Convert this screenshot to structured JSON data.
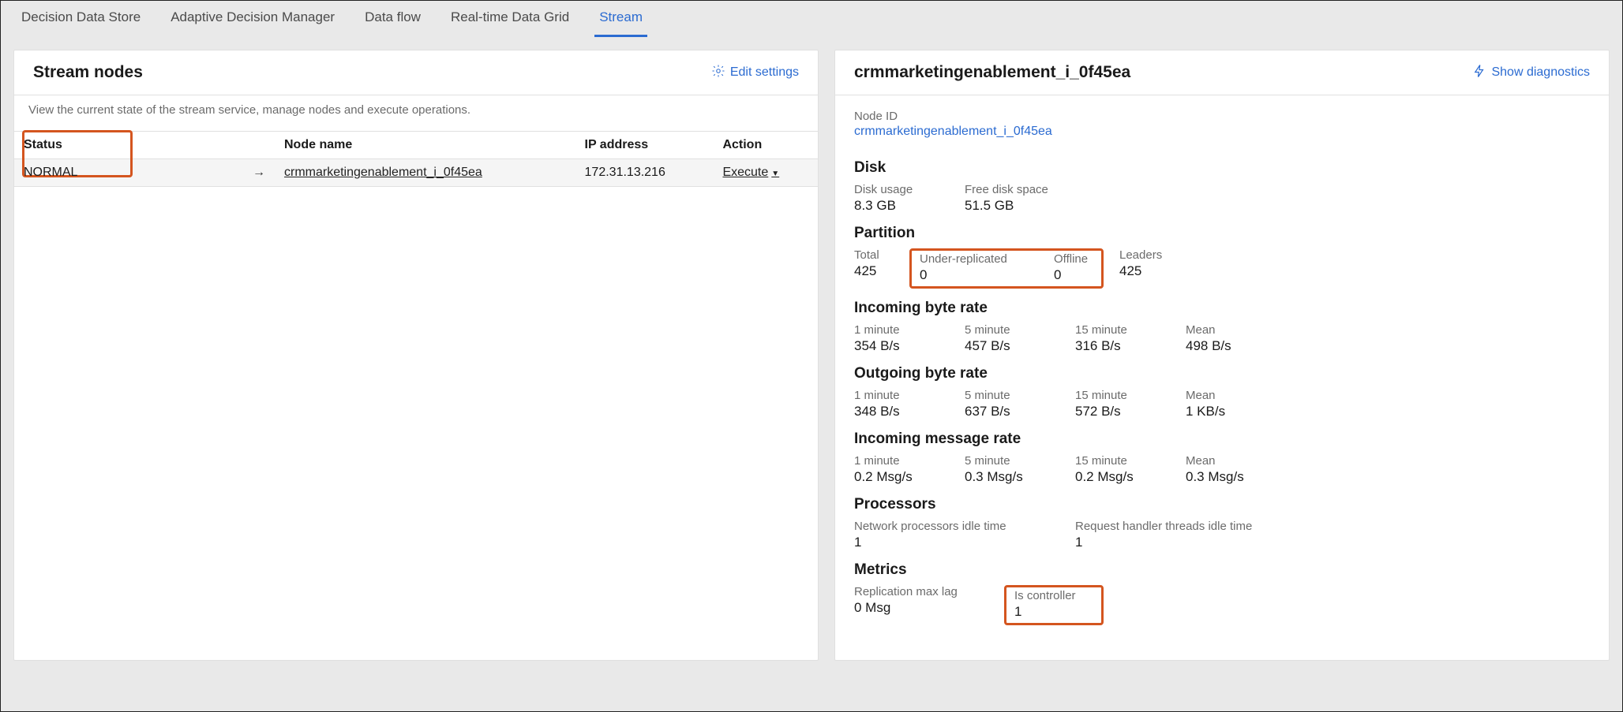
{
  "tabs": {
    "items": [
      {
        "label": "Decision Data Store",
        "active": false
      },
      {
        "label": "Adaptive Decision Manager",
        "active": false
      },
      {
        "label": "Data flow",
        "active": false
      },
      {
        "label": "Real-time Data Grid",
        "active": false
      },
      {
        "label": "Stream",
        "active": true
      }
    ]
  },
  "left": {
    "title": "Stream nodes",
    "edit_label": "Edit settings",
    "description": "View the current state of the stream service, manage nodes and execute operations.",
    "columns": {
      "status": "Status",
      "node_name": "Node name",
      "ip": "IP address",
      "action": "Action"
    },
    "rows": [
      {
        "status": "NORMAL",
        "node_name": "crmmarketingenablement_i_0f45ea",
        "ip": "172.31.13.216",
        "action": "Execute"
      }
    ]
  },
  "right": {
    "title": "crmmarketingenablement_i_0f45ea",
    "diag_label": "Show diagnostics",
    "node_id_label": "Node ID",
    "node_id_value": "crmmarketingenablement_i_0f45ea",
    "disk": {
      "heading": "Disk",
      "usage_label": "Disk usage",
      "usage_value": "8.3 GB",
      "free_label": "Free disk space",
      "free_value": "51.5 GB"
    },
    "partition": {
      "heading": "Partition",
      "total_label": "Total",
      "total_value": "425",
      "under_label": "Under-replicated",
      "under_value": "0",
      "offline_label": "Offline",
      "offline_value": "0",
      "leaders_label": "Leaders",
      "leaders_value": "425"
    },
    "in_byte": {
      "heading": "Incoming byte rate",
      "m1_label": "1 minute",
      "m1_value": "354 B/s",
      "m5_label": "5 minute",
      "m5_value": "457 B/s",
      "m15_label": "15 minute",
      "m15_value": "316 B/s",
      "mean_label": "Mean",
      "mean_value": "498 B/s"
    },
    "out_byte": {
      "heading": "Outgoing byte rate",
      "m1_label": "1 minute",
      "m1_value": "348 B/s",
      "m5_label": "5 minute",
      "m5_value": "637 B/s",
      "m15_label": "15 minute",
      "m15_value": "572 B/s",
      "mean_label": "Mean",
      "mean_value": "1 KB/s"
    },
    "in_msg": {
      "heading": "Incoming message rate",
      "m1_label": "1 minute",
      "m1_value": "0.2 Msg/s",
      "m5_label": "5 minute",
      "m5_value": "0.3 Msg/s",
      "m15_label": "15 minute",
      "m15_value": "0.2 Msg/s",
      "mean_label": "Mean",
      "mean_value": "0.3 Msg/s"
    },
    "processors": {
      "heading": "Processors",
      "net_label": "Network processors idle time",
      "net_value": "1",
      "req_label": "Request handler threads idle time",
      "req_value": "1"
    },
    "metrics": {
      "heading": "Metrics",
      "repl_label": "Replication max lag",
      "repl_value": "0 Msg",
      "ctrl_label": "Is controller",
      "ctrl_value": "1"
    }
  }
}
